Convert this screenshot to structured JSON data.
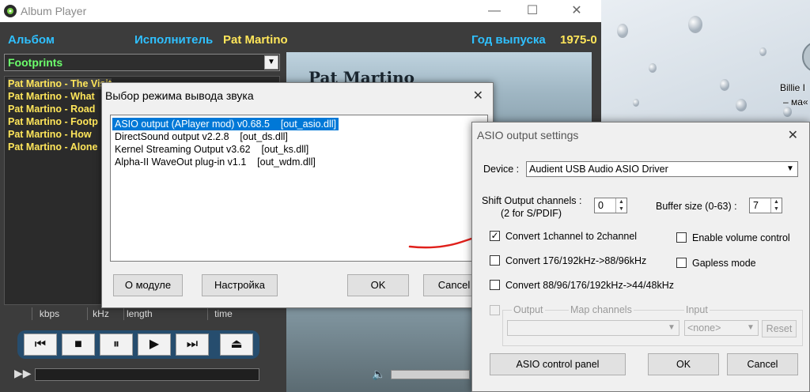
{
  "desktop": {
    "label_line1": "Billie I",
    "label_line2": "– ма«"
  },
  "player": {
    "title": "Album Player",
    "window_controls": {
      "minimize": "—",
      "maximize": "☐",
      "close": "✕"
    },
    "header": {
      "album_label": "Альбом",
      "artist_label": "Исполнитель",
      "artist_value": "Pat Martino",
      "year_label": "Год выпуска",
      "year_value": "1975-0"
    },
    "album_selected": "Footprints",
    "tracks": [
      "Pat Martino - The Visit",
      "Pat Martino - What",
      "Pat Martino - Road",
      "Pat Martino - Footp",
      "Pat Martino - How",
      "Pat Martino - Alone"
    ],
    "columns": [
      "kbps",
      "kHz",
      "length",
      "time"
    ],
    "cover_artist": "Pat Martino",
    "controls": {
      "prev": "⏮",
      "stop": "■",
      "pause": "⏸",
      "play": "▶",
      "next": "⏭",
      "eject": "⏏"
    },
    "colors": {
      "cyan": "#2fc0ff",
      "yellow": "#ffe65a",
      "green": "#6cff6c",
      "control_panel": "#264d6e"
    }
  },
  "output_dialog": {
    "title": "Выбор режима вывода звука",
    "close": "✕",
    "items": [
      "ASIO output (APlayer mod) v0.68.5    [out_asio.dll]",
      "DirectSound output v2.2.8    [out_ds.dll]",
      "Kernel Streaming Output v3.62    [out_ks.dll]",
      "Alpha-II WaveOut plug-in v1.1    [out_wdm.dll]"
    ],
    "buttons": {
      "about": "О модуле",
      "settings": "Настройка",
      "ok": "OK",
      "cancel": "Cancel"
    }
  },
  "asio_dialog": {
    "title": "ASIO output settings",
    "close": "✕",
    "device_label": "Device :",
    "device_value": "Audient USB Audio ASIO Driver",
    "shift_label_line1": "Shift Output channels :",
    "shift_label_line2": "(2 for S/PDIF)",
    "shift_value": "0",
    "buffer_label": "Buffer size (0-63) :",
    "buffer_value": "7",
    "checkboxes": {
      "convert_1to2": {
        "label": "Convert 1channel to 2channel",
        "checked": true
      },
      "convert_176": {
        "label": "Convert 176/192kHz->88/96kHz",
        "checked": false
      },
      "convert_88": {
        "label": "Convert 88/96/176/192kHz->44/48kHz",
        "checked": false
      },
      "enable_volume": {
        "label": "Enable volume control",
        "checked": false
      },
      "gapless": {
        "label": "Gapless mode",
        "checked": false
      }
    },
    "group": {
      "output_label": "Output",
      "map_label": "Map channels",
      "input_label": "Input",
      "input_value": "<none>",
      "reset_label": "Reset"
    },
    "buttons": {
      "control_panel": "ASIO control panel",
      "ok": "OK",
      "cancel": "Cancel"
    }
  }
}
